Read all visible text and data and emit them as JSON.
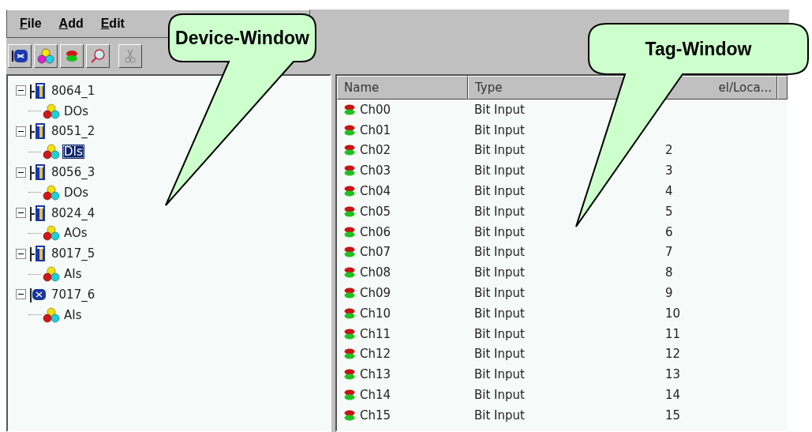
{
  "menu": [
    {
      "label": "File"
    },
    {
      "label": "Add"
    },
    {
      "label": "Edit"
    }
  ],
  "device_tree": [
    {
      "name": "8064_1",
      "kind": "module",
      "expanded": true,
      "children": [
        {
          "name": "DOs",
          "selected": false
        }
      ]
    },
    {
      "name": "8051_2",
      "kind": "module",
      "expanded": true,
      "children": [
        {
          "name": "DIs",
          "selected": true
        }
      ]
    },
    {
      "name": "8056_3",
      "kind": "module",
      "expanded": true,
      "children": [
        {
          "name": "DOs",
          "selected": false
        }
      ]
    },
    {
      "name": "8024_4",
      "kind": "module",
      "expanded": true,
      "children": [
        {
          "name": "AOs",
          "selected": false
        }
      ]
    },
    {
      "name": "8017_5",
      "kind": "module",
      "expanded": true,
      "children": [
        {
          "name": "AIs",
          "selected": false
        }
      ]
    },
    {
      "name": "7017_6",
      "kind": "remote",
      "expanded": true,
      "children": [
        {
          "name": "AIs",
          "selected": false
        }
      ]
    }
  ],
  "tag_list": {
    "columns": [
      {
        "label": "Name"
      },
      {
        "label": "Type"
      },
      {
        "label": "el/Loca..."
      }
    ],
    "rows": [
      {
        "name": "Ch00",
        "type": "Bit Input"
      },
      {
        "name": "Ch01",
        "type": "Bit Input"
      },
      {
        "name": "Ch02",
        "type": "Bit Input",
        "address": "2"
      },
      {
        "name": "Ch03",
        "type": "Bit Input",
        "address": "3"
      },
      {
        "name": "Ch04",
        "type": "Bit Input",
        "address": "4"
      },
      {
        "name": "Ch05",
        "type": "Bit Input",
        "address": "5"
      },
      {
        "name": "Ch06",
        "type": "Bit Input",
        "address": "6"
      },
      {
        "name": "Ch07",
        "type": "Bit Input",
        "address": "7"
      },
      {
        "name": "Ch08",
        "type": "Bit Input",
        "address": "8"
      },
      {
        "name": "Ch09",
        "type": "Bit Input",
        "address": "9"
      },
      {
        "name": "Ch10",
        "type": "Bit Input",
        "address": "10"
      },
      {
        "name": "Ch11",
        "type": "Bit Input",
        "address": "11"
      },
      {
        "name": "Ch12",
        "type": "Bit Input",
        "address": "12"
      },
      {
        "name": "Ch13",
        "type": "Bit Input",
        "address": "13"
      },
      {
        "name": "Ch14",
        "type": "Bit Input",
        "address": "14"
      },
      {
        "name": "Ch15",
        "type": "Bit Input",
        "address": "15"
      }
    ]
  },
  "callouts": [
    {
      "label": "Device-Window"
    },
    {
      "label": "Tag-Window"
    }
  ]
}
